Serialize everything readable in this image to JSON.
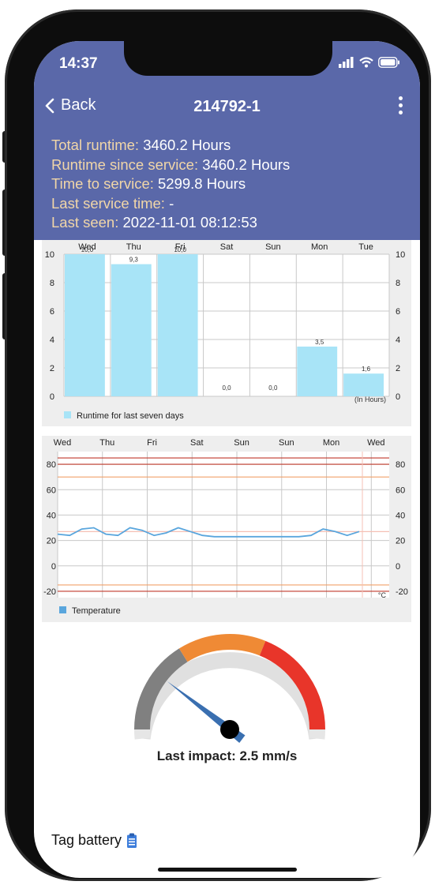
{
  "status_bar": {
    "time": "14:37"
  },
  "nav": {
    "back_label": "Back",
    "title": "214792-1"
  },
  "info": [
    {
      "label": "Total runtime:",
      "value": "3460.2 Hours"
    },
    {
      "label": "Runtime since service:",
      "value": "3460.2 Hours"
    },
    {
      "label": "Time to service:",
      "value": "5299.8 Hours"
    },
    {
      "label": "Last service time:",
      "value": "-"
    },
    {
      "label": "Last seen:",
      "value": "2022-11-01 08:12:53"
    }
  ],
  "chart_data": [
    {
      "type": "bar",
      "categories": [
        "Wed",
        "Thu",
        "Fri",
        "Sat",
        "Sun",
        "Mon",
        "Tue"
      ],
      "values": [
        10.0,
        9.3,
        10.0,
        0.0,
        0.0,
        3.5,
        1.6
      ],
      "value_labels": [
        "10,0",
        "9,3",
        "10,0",
        "0,0",
        "0,0",
        "3,5",
        "1,6"
      ],
      "yticks": [
        0,
        2,
        4,
        6,
        8,
        10
      ],
      "ylim": [
        0,
        10
      ],
      "unit_label": "(In Hours)",
      "legend": "Runtime for last seven days",
      "color": "#a8e4f7",
      "grid": true
    },
    {
      "type": "line",
      "xticks": [
        "Wed",
        "Thu",
        "Fri",
        "Sat",
        "Sun",
        "Sun",
        "Mon",
        "Wed"
      ],
      "yticks": [
        -20,
        0,
        20,
        40,
        60,
        80
      ],
      "ylim": [
        -25,
        90
      ],
      "unit_label": "°C",
      "legend": "Temperature",
      "color": "#5aa6dd",
      "reference_lines": [
        {
          "value": 85,
          "color": "#c0392b"
        },
        {
          "value": 80,
          "color": "#c0392b"
        },
        {
          "value": 70,
          "color": "#f0a06a"
        },
        {
          "value": 27,
          "color": "#f5c0b5"
        },
        {
          "value": -15,
          "color": "#f0a06a"
        },
        {
          "value": -20,
          "color": "#c0392b"
        }
      ],
      "series": [
        {
          "values": [
            25,
            24,
            29,
            30,
            25,
            24,
            30,
            28,
            24,
            26,
            30,
            27,
            24,
            23,
            23,
            23,
            23,
            23,
            23,
            23,
            23,
            24,
            29,
            27,
            24,
            27
          ]
        }
      ]
    }
  ],
  "gauge": {
    "value_fraction": 0.12,
    "colors": {
      "low": "#808080",
      "mid": "#ef8a35",
      "high": "#e8352a",
      "needle": "#3a6fb0"
    }
  },
  "impact": {
    "text": "Last impact: 2.5 mm/s"
  },
  "battery": {
    "label": "Tag battery"
  },
  "colors": {
    "header": "#5a68a9",
    "label": "#f1d6a8"
  }
}
